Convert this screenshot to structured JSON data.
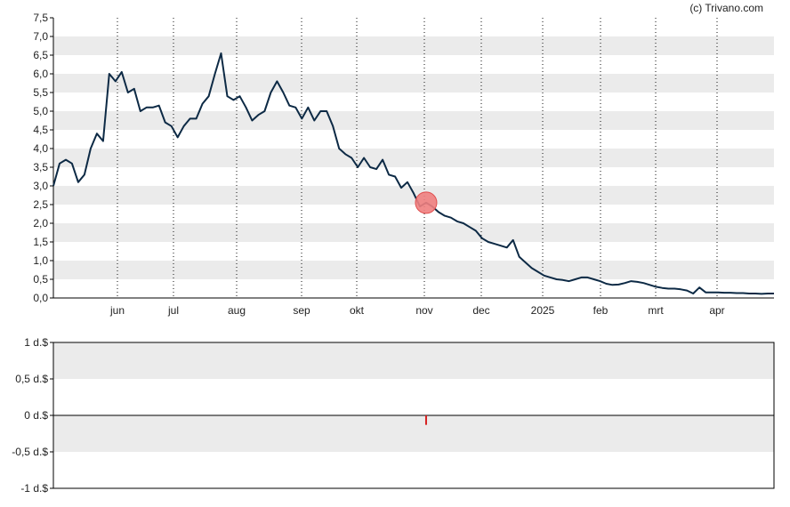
{
  "credit": "(c) Trivano.com",
  "colors": {
    "line": "#0d2a45",
    "band": "#ebebeb",
    "grid": "#111111",
    "marker_fill": "#f08080",
    "marker_stroke": "#e05050",
    "volume_tick": "#d62020",
    "axis": "#000000"
  },
  "chart_data": [
    {
      "type": "line",
      "name": "price",
      "y_ticks": [
        "0,0",
        "0,5",
        "1,0",
        "1,5",
        "2,0",
        "2,5",
        "3,0",
        "3,5",
        "4,0",
        "4,5",
        "5,0",
        "5,5",
        "6,0",
        "6,5",
        "7,0",
        "7,5"
      ],
      "ylim": [
        0,
        7.5
      ],
      "x_month_labels": [
        "jun",
        "jul",
        "aug",
        "sep",
        "okt",
        "nov",
        "dec",
        "2025",
        "feb",
        "mrt",
        "apr"
      ],
      "grid": "vertical dotted at month starts, horizontal alternating bands",
      "series_points": [
        [
          0,
          3.0
        ],
        [
          1,
          3.6
        ],
        [
          2,
          3.7
        ],
        [
          3,
          3.6
        ],
        [
          4,
          3.1
        ],
        [
          5,
          3.3
        ],
        [
          6,
          4.0
        ],
        [
          7,
          4.4
        ],
        [
          8,
          4.2
        ],
        [
          9,
          6.0
        ],
        [
          10,
          5.8
        ],
        [
          11,
          6.05
        ],
        [
          12,
          5.5
        ],
        [
          13,
          5.6
        ],
        [
          14,
          5.0
        ],
        [
          15,
          5.1
        ],
        [
          16,
          5.1
        ],
        [
          17,
          5.15
        ],
        [
          18,
          4.7
        ],
        [
          19,
          4.6
        ],
        [
          20,
          4.3
        ],
        [
          21,
          4.6
        ],
        [
          22,
          4.8
        ],
        [
          23,
          4.8
        ],
        [
          24,
          5.2
        ],
        [
          25,
          5.4
        ],
        [
          26,
          6.0
        ],
        [
          27,
          6.55
        ],
        [
          28,
          5.4
        ],
        [
          29,
          5.3
        ],
        [
          30,
          5.4
        ],
        [
          31,
          5.1
        ],
        [
          32,
          4.75
        ],
        [
          33,
          4.9
        ],
        [
          34,
          5.0
        ],
        [
          35,
          5.5
        ],
        [
          36,
          5.8
        ],
        [
          37,
          5.5
        ],
        [
          38,
          5.15
        ],
        [
          39,
          5.1
        ],
        [
          40,
          4.8
        ],
        [
          41,
          5.1
        ],
        [
          42,
          4.75
        ],
        [
          43,
          5.0
        ],
        [
          44,
          5.0
        ],
        [
          45,
          4.6
        ],
        [
          46,
          4.0
        ],
        [
          47,
          3.85
        ],
        [
          48,
          3.75
        ],
        [
          49,
          3.5
        ],
        [
          50,
          3.75
        ],
        [
          51,
          3.5
        ],
        [
          52,
          3.45
        ],
        [
          53,
          3.7
        ],
        [
          54,
          3.3
        ],
        [
          55,
          3.25
        ],
        [
          56,
          2.95
        ],
        [
          57,
          3.1
        ],
        [
          58,
          2.8
        ],
        [
          59,
          2.45
        ],
        [
          60,
          2.55
        ],
        [
          61,
          2.45
        ],
        [
          62,
          2.3
        ],
        [
          63,
          2.2
        ],
        [
          64,
          2.15
        ],
        [
          65,
          2.05
        ],
        [
          66,
          2.0
        ],
        [
          67,
          1.9
        ],
        [
          68,
          1.8
        ],
        [
          69,
          1.6
        ],
        [
          70,
          1.5
        ],
        [
          71,
          1.45
        ],
        [
          72,
          1.4
        ],
        [
          73,
          1.35
        ],
        [
          74,
          1.55
        ],
        [
          75,
          1.1
        ],
        [
          76,
          0.95
        ],
        [
          77,
          0.8
        ],
        [
          78,
          0.7
        ],
        [
          79,
          0.6
        ],
        [
          80,
          0.55
        ],
        [
          81,
          0.5
        ],
        [
          82,
          0.48
        ],
        [
          83,
          0.45
        ],
        [
          84,
          0.5
        ],
        [
          85,
          0.55
        ],
        [
          86,
          0.55
        ],
        [
          87,
          0.5
        ],
        [
          88,
          0.45
        ],
        [
          89,
          0.38
        ],
        [
          90,
          0.35
        ],
        [
          91,
          0.36
        ],
        [
          92,
          0.4
        ],
        [
          93,
          0.45
        ],
        [
          94,
          0.43
        ],
        [
          95,
          0.4
        ],
        [
          96,
          0.35
        ],
        [
          97,
          0.3
        ],
        [
          98,
          0.27
        ],
        [
          99,
          0.25
        ],
        [
          100,
          0.25
        ],
        [
          101,
          0.23
        ],
        [
          102,
          0.2
        ],
        [
          103,
          0.12
        ],
        [
          104,
          0.28
        ],
        [
          105,
          0.15
        ],
        [
          106,
          0.15
        ],
        [
          107,
          0.15
        ],
        [
          108,
          0.14
        ],
        [
          109,
          0.14
        ],
        [
          110,
          0.13
        ],
        [
          111,
          0.13
        ],
        [
          112,
          0.12
        ],
        [
          113,
          0.12
        ],
        [
          114,
          0.11
        ],
        [
          115,
          0.12
        ],
        [
          116,
          0.12
        ]
      ],
      "marker_at_point": 60
    },
    {
      "type": "bar",
      "name": "volume",
      "y_ticks": [
        "1 d.$",
        "0,5 d.$",
        "0 d.$",
        "-0,5 d.$",
        "-1 d.$"
      ],
      "ylim": [
        -1,
        1
      ],
      "bars": [
        {
          "at_point": 60,
          "value": -0.13
        }
      ]
    }
  ]
}
